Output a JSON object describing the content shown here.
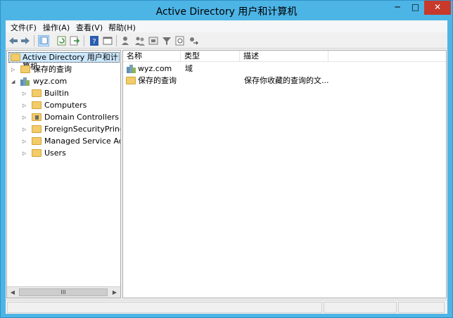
{
  "window": {
    "title": "Active Directory 用户和计算机",
    "min_glyph": "─",
    "max_glyph": "□",
    "close_glyph": "✕"
  },
  "menu": [
    {
      "label": "文件(F)"
    },
    {
      "label": "操作(A)"
    },
    {
      "label": "查看(V)"
    },
    {
      "label": "帮助(H)"
    }
  ],
  "toolbar": {
    "icons": [
      "back-arrow-icon",
      "forward-arrow-icon",
      "console-tree-icon",
      "refresh-icon",
      "export-icon",
      "help-icon",
      "properties-icon",
      "add-user-icon",
      "add-group-icon",
      "add-ou-icon",
      "filter-icon",
      "find-icon",
      "move-icon"
    ]
  },
  "tree": {
    "root": "Active Directory 用户和计算机",
    "saved_queries": "保存的查询",
    "domain": "wyz.com",
    "children": [
      {
        "label": "Builtin",
        "type": "folder"
      },
      {
        "label": "Computers",
        "type": "folder"
      },
      {
        "label": "Domain Controllers",
        "type": "ou"
      },
      {
        "label": "ForeignSecurityPrincipals",
        "type": "folder"
      },
      {
        "label": "Managed Service Accounts",
        "type": "folder"
      },
      {
        "label": "Users",
        "type": "folder"
      }
    ],
    "expand_glyph": "▷",
    "collapse_glyph": "◢",
    "scroll_left": "◀",
    "scroll_right": "▶",
    "scroll_thumb": "III"
  },
  "list": {
    "columns": [
      "名称",
      "类型",
      "描述"
    ],
    "rows": [
      {
        "name": "wyz.com",
        "type": "域",
        "desc": "",
        "icon": "domain"
      },
      {
        "name": "保存的查询",
        "type": "",
        "desc": "保存你收藏的查询的文...",
        "icon": "folder"
      }
    ]
  },
  "colors": {
    "titlebar": "#4db4e6",
    "close": "#c7392b",
    "folder": "#f2cb6a",
    "selection": "#cce8ff"
  }
}
